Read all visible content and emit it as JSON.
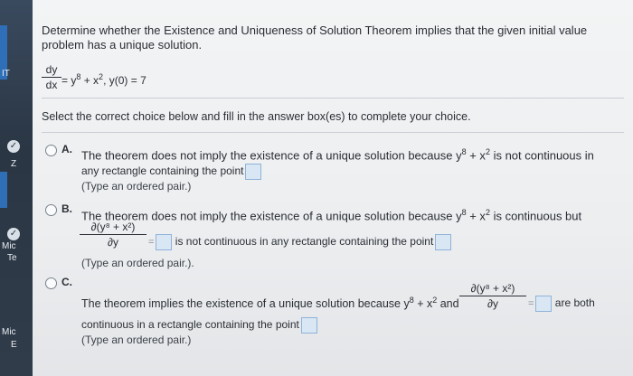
{
  "question": {
    "line1": "Determine whether the Existence and Uniqueness of Solution Theorem implies that the given initial value",
    "line2": "problem has a unique solution.",
    "eq_num": "dy",
    "eq_den": "dx",
    "eq_rhs": "= y",
    "eq_exp8": "8",
    "eq_plus": " + x",
    "eq_exp2": "2",
    "eq_ic": ",   y(0) = 7"
  },
  "instruction": "Select the correct choice below and fill in the answer box(es) to complete your choice.",
  "choice_a": {
    "letter": "A.",
    "text1": "The theorem does not imply the existence of a unique solution because y",
    "sup8": "8",
    "mid": " + x",
    "sup2": "2",
    "text2": " is not continuous in",
    "line2": "any rectangle containing the point",
    "hint": "(Type an ordered pair.)"
  },
  "choice_b": {
    "letter": "B.",
    "text1": "The theorem does not imply the existence of a unique solution because y",
    "sup8": "8",
    "mid": " + x",
    "sup2": "2",
    "text2": " is continuous but",
    "frac_num": "∂(y⁸ + x²)",
    "frac_den": "∂y",
    "eq": "=",
    "after": "is not continuous in any rectangle containing the point",
    "hint": "(Type an ordered pair.)."
  },
  "choice_c": {
    "letter": "C.",
    "text1": "The theorem implies the existence of a unique solution because y",
    "sup8": "8",
    "mid": " + x",
    "sup2": "2",
    "and": " and",
    "frac_num": "∂(y⁸ + x²)",
    "frac_den": "∂y",
    "eq": "=",
    "after": "are both",
    "line2": "continuous in a rectangle containing the point",
    "hint": "(Type an ordered pair.)"
  },
  "left_labels": [
    "Mic",
    "Te",
    "Mic",
    "E",
    "Z",
    "IT"
  ],
  "colors": {
    "accent": "#2f6fb8",
    "answer_box": "#d9e6f3"
  }
}
